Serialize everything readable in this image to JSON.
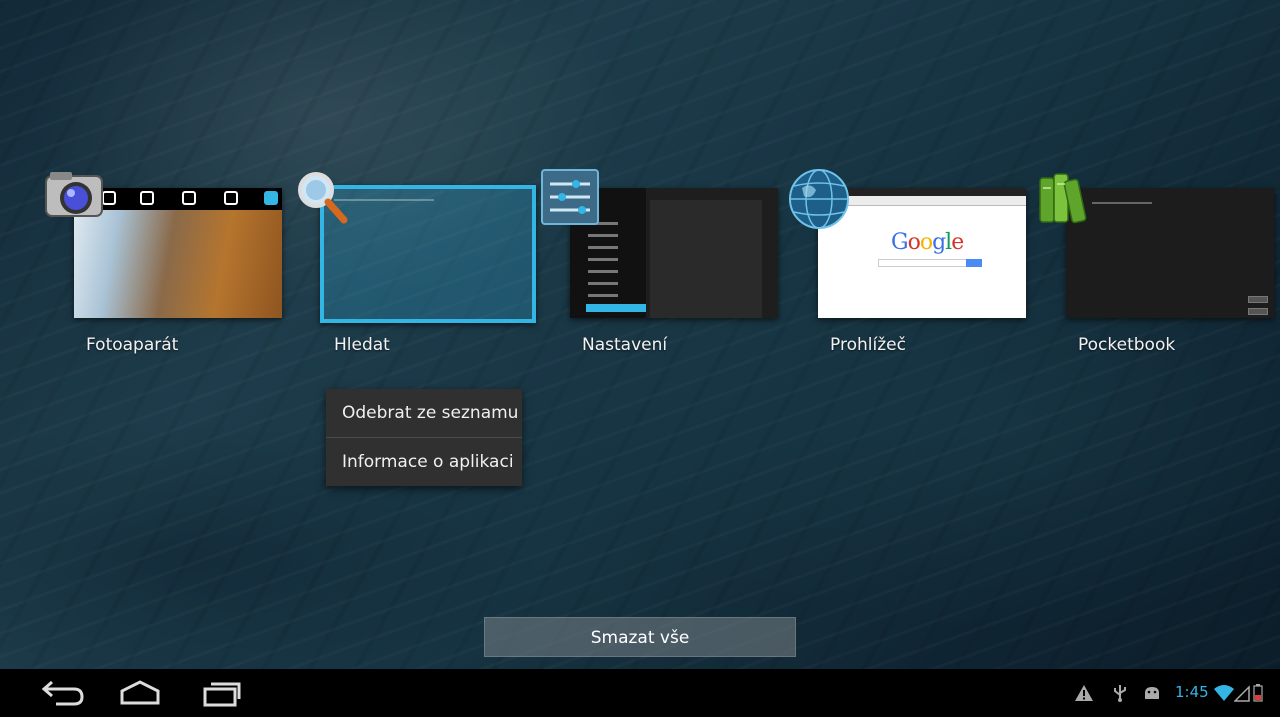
{
  "recents": [
    {
      "label": "Fotoaparát",
      "icon": "camera-icon"
    },
    {
      "label": "Hledat",
      "icon": "search-icon"
    },
    {
      "label": "Nastavení",
      "icon": "settings-icon"
    },
    {
      "label": "Prohlížeč",
      "icon": "globe-icon"
    },
    {
      "label": "Pocketbook",
      "icon": "books-icon"
    }
  ],
  "browser_thumb": {
    "logo": "Google"
  },
  "context_menu": {
    "items": [
      "Odebrat ze seznamu",
      "Informace o aplikaci"
    ]
  },
  "clear_all_label": "Smazat vše",
  "status_bar": {
    "time": "1:45",
    "icons": [
      "warning-icon",
      "usb-icon",
      "android-debug-icon",
      "wifi-icon",
      "signal-icon",
      "battery-icon"
    ]
  },
  "colors": {
    "accent": "#33b5e5",
    "battery": "#e53935"
  }
}
